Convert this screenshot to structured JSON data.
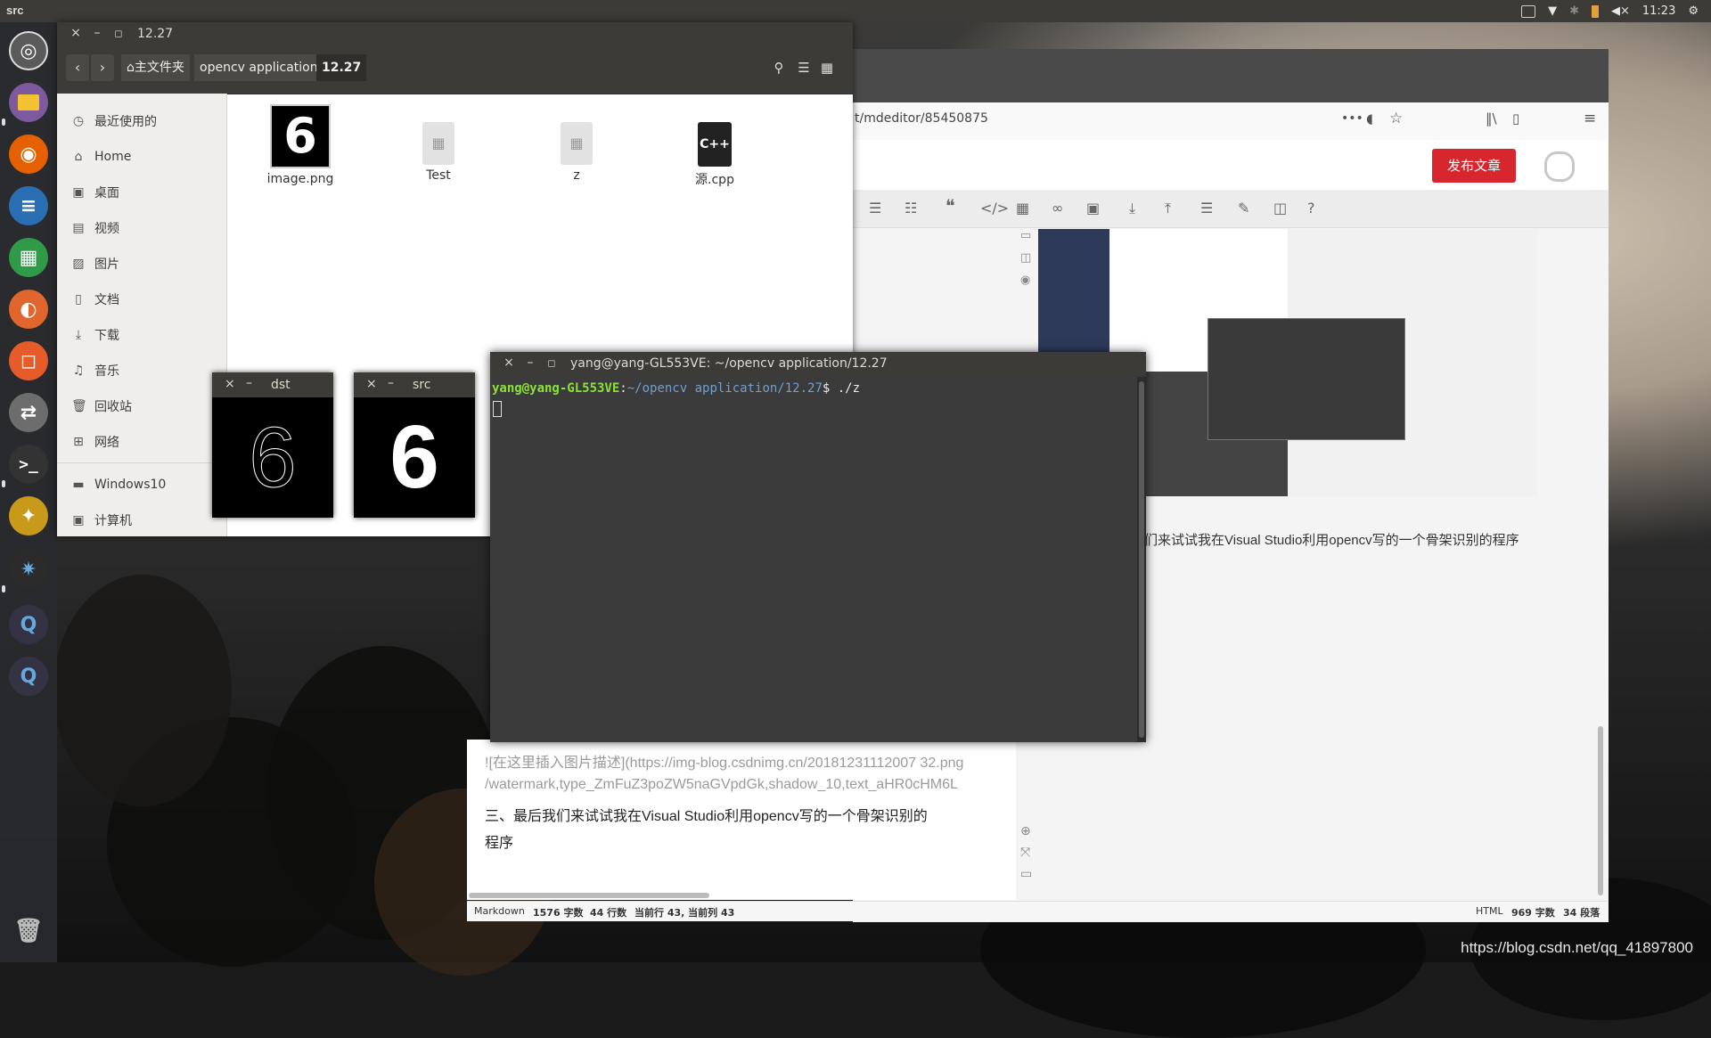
{
  "top_panel": {
    "app_title": "src",
    "clock": "11:23"
  },
  "launcher": {
    "items": [
      "ubuntu-dash-icon",
      "files-icon",
      "firefox-icon",
      "writer-icon",
      "calc-icon",
      "photos-icon",
      "screenshot-icon",
      "settings-toggle-icon",
      "terminal-icon",
      "app-icon",
      "gear-app-icon",
      "qt-icon",
      "qt-icon-2"
    ]
  },
  "file_manager": {
    "title": "12.27",
    "breadcrumb": [
      "主文件夹",
      "opencv application",
      "12.27"
    ],
    "sidebar": [
      {
        "label": "最近使用的",
        "icon": "clock-icon"
      },
      {
        "label": "Home",
        "icon": "home-icon"
      },
      {
        "label": "桌面",
        "icon": "desktop-icon"
      },
      {
        "label": "视频",
        "icon": "video-icon"
      },
      {
        "label": "图片",
        "icon": "picture-icon"
      },
      {
        "label": "文档",
        "icon": "document-icon"
      },
      {
        "label": "下载",
        "icon": "download-icon"
      },
      {
        "label": "音乐",
        "icon": "music-icon"
      },
      {
        "label": "回收站",
        "icon": "trash-icon"
      },
      {
        "label": "网络",
        "icon": "network-icon"
      },
      {
        "label": "Windows10",
        "icon": "drive-icon"
      },
      {
        "label": "计算机",
        "icon": "computer-icon"
      }
    ],
    "files": [
      {
        "name": "image.png",
        "thumb_text": "6"
      },
      {
        "name": "Test"
      },
      {
        "name": "z"
      },
      {
        "name": "源.cpp",
        "badge": "C++"
      }
    ]
  },
  "cv_windows": [
    {
      "title": "dst",
      "digit": "6"
    },
    {
      "title": "src",
      "digit": "6"
    }
  ],
  "terminal": {
    "title": "yang@yang-GL553VE: ~/opencv application/12.27",
    "prompt_user": "yang@yang-GL553VE",
    "prompt_path": "~/opencv application/12.27",
    "command": "./z"
  },
  "browser": {
    "url": "t/mdeditor/85450875",
    "publish_button": "发布文章",
    "preview_text": "们来试试我在Visual Studio利用opencv写的一个骨架识别的程序",
    "markdown_lines": [
      "![在这里插入图片描述](https://img-blog.csdnimg.cn/20181231112007 32.png",
      "/watermark,type_ZmFuZ3poZW5naGVpdGk,shadow_10,text_aHR0cHM6L",
      "三、最后我们来试试我在Visual Studio利用opencv写的一个骨架识别的",
      "程序"
    ],
    "status_left": {
      "mode": "Markdown",
      "chars": "1576 字数",
      "lines": "44 行数",
      "current_line": "当前行 43, 当前列 43"
    },
    "status_right": {
      "mode": "HTML",
      "chars": "969 字数",
      "paragraphs": "34 段落"
    }
  },
  "watermark": "https://blog.csdn.net/qq_41897800"
}
